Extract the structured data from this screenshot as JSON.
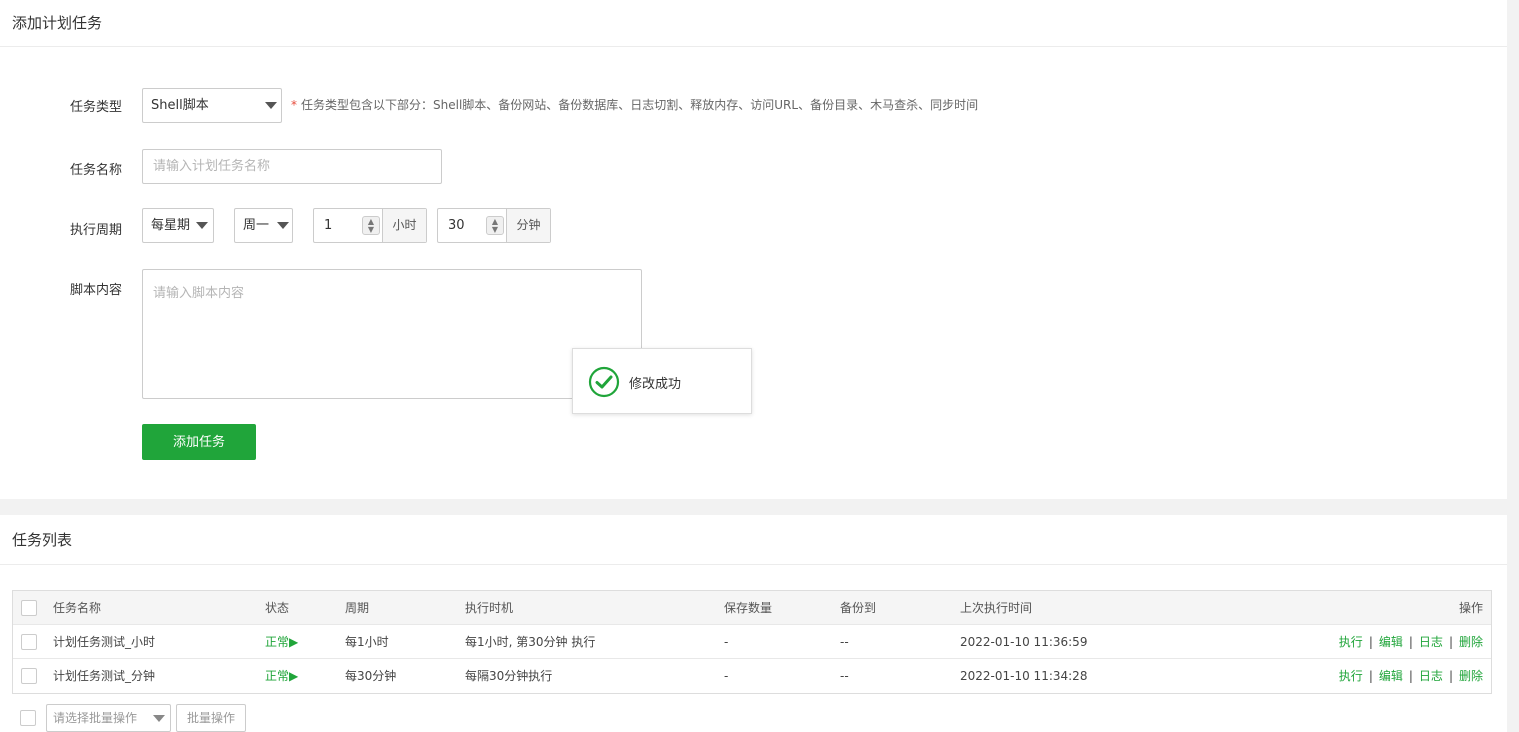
{
  "add_panel": {
    "title": "添加计划任务",
    "task_type_label": "任务类型",
    "task_type_value": "Shell脚本",
    "task_type_hint_star": "*",
    "task_type_hint": "任务类型包含以下部分：Shell脚本、备份网站、备份数据库、日志切割、释放内存、访问URL、备份目录、木马查杀、同步时间",
    "task_name_label": "任务名称",
    "task_name_placeholder": "请输入计划任务名称",
    "cycle_label": "执行周期",
    "cycle_type": "每星期",
    "cycle_weekday": "周一",
    "cycle_hour": "1",
    "cycle_hour_unit": "小时",
    "cycle_minute": "30",
    "cycle_minute_unit": "分钟",
    "script_label": "脚本内容",
    "script_placeholder": "请输入脚本内容",
    "submit_label": "添加任务"
  },
  "toast": {
    "message": "修改成功"
  },
  "list_panel": {
    "title": "任务列表",
    "columns": [
      "任务名称",
      "状态",
      "周期",
      "执行时机",
      "保存数量",
      "备份到",
      "上次执行时间",
      "操作"
    ],
    "rows": [
      {
        "name": "计划任务测试_小时",
        "status": "正常▶",
        "cycle": "每1小时",
        "timing": "每1小时, 第30分钟 执行",
        "save_count": "-",
        "backup_to": "--",
        "last_run": "2022-01-10 11:36:59"
      },
      {
        "name": "计划任务测试_分钟",
        "status": "正常▶",
        "cycle": "每30分钟",
        "timing": "每隔30分钟执行",
        "save_count": "-",
        "backup_to": "--",
        "last_run": "2022-01-10 11:34:28"
      }
    ],
    "ops": {
      "run": "执行",
      "edit": "编辑",
      "log": "日志",
      "delete": "删除",
      "separator": "|"
    },
    "batch_select_placeholder": "请选择批量操作",
    "batch_button": "批量操作"
  },
  "colors": {
    "accent": "#20a53a",
    "hint_star": "#e74c3c"
  }
}
